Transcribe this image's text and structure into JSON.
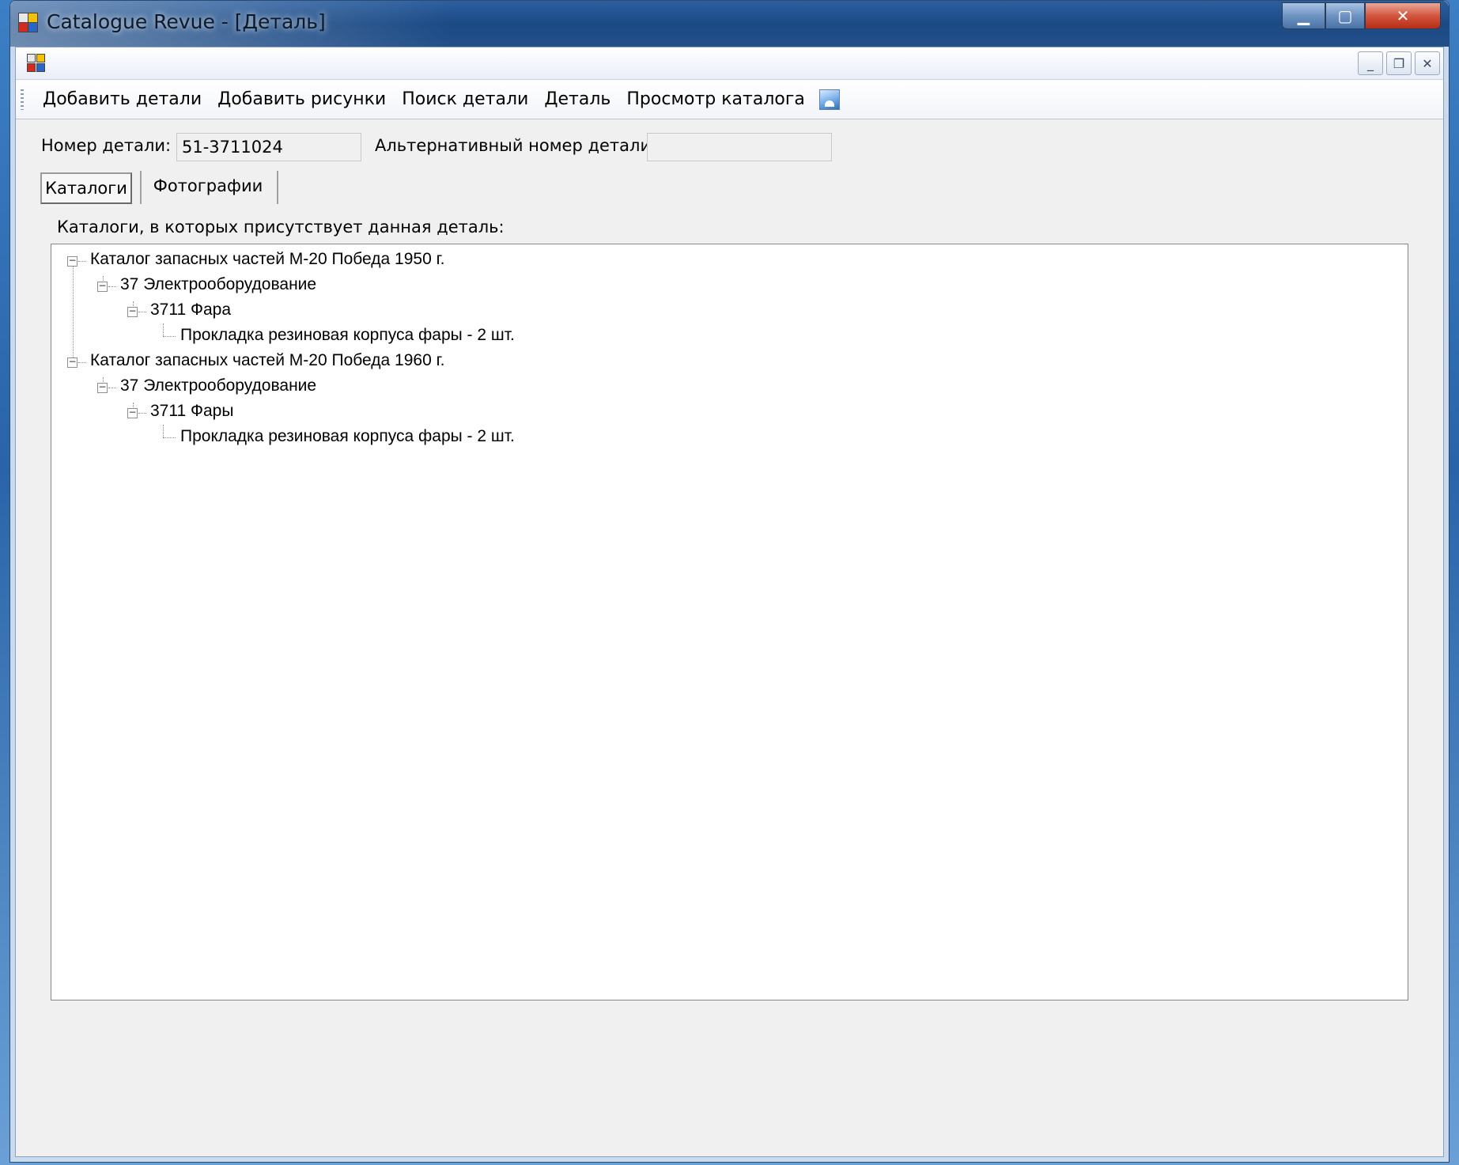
{
  "window": {
    "title": "Catalogue Revue - [Деталь]",
    "controls": {
      "minimize": "▁",
      "maximize": "▢",
      "close": "✕"
    }
  },
  "mdi": {
    "controls": {
      "minimize": "_",
      "restore": "❐",
      "close": "✕"
    }
  },
  "menu": {
    "items": [
      {
        "label": "Добавить детали"
      },
      {
        "label": "Добавить рисунки"
      },
      {
        "label": "Поиск детали"
      },
      {
        "label": "Деталь"
      },
      {
        "label": "Просмотр каталога"
      }
    ],
    "image_icon": "picture-icon"
  },
  "form": {
    "part_number_label": "Номер детали:",
    "part_number_value": "51-3711024",
    "alt_number_label": "Альтернативный номер детали:",
    "alt_number_value": ""
  },
  "tabs": [
    {
      "label": "Каталоги",
      "active": true
    },
    {
      "label": "Фотографии",
      "active": false
    }
  ],
  "tree": {
    "caption": "Каталоги, в которых присутствует данная деталь:",
    "nodes": [
      {
        "label": "Каталог запасных частей М-20 Победа 1950 г."
      },
      {
        "label": "37 Электрооборудование"
      },
      {
        "label": "3711 Фара"
      },
      {
        "label": "Прокладка резиновая корпуса фары - 2 шт."
      },
      {
        "label": "Каталог запасных частей М-20 Победа 1960 г."
      },
      {
        "label": "37 Электрооборудование"
      },
      {
        "label": "3711 Фары"
      },
      {
        "label": "Прокладка резиновая корпуса фары - 2 шт."
      }
    ],
    "expander_symbol": "−"
  }
}
